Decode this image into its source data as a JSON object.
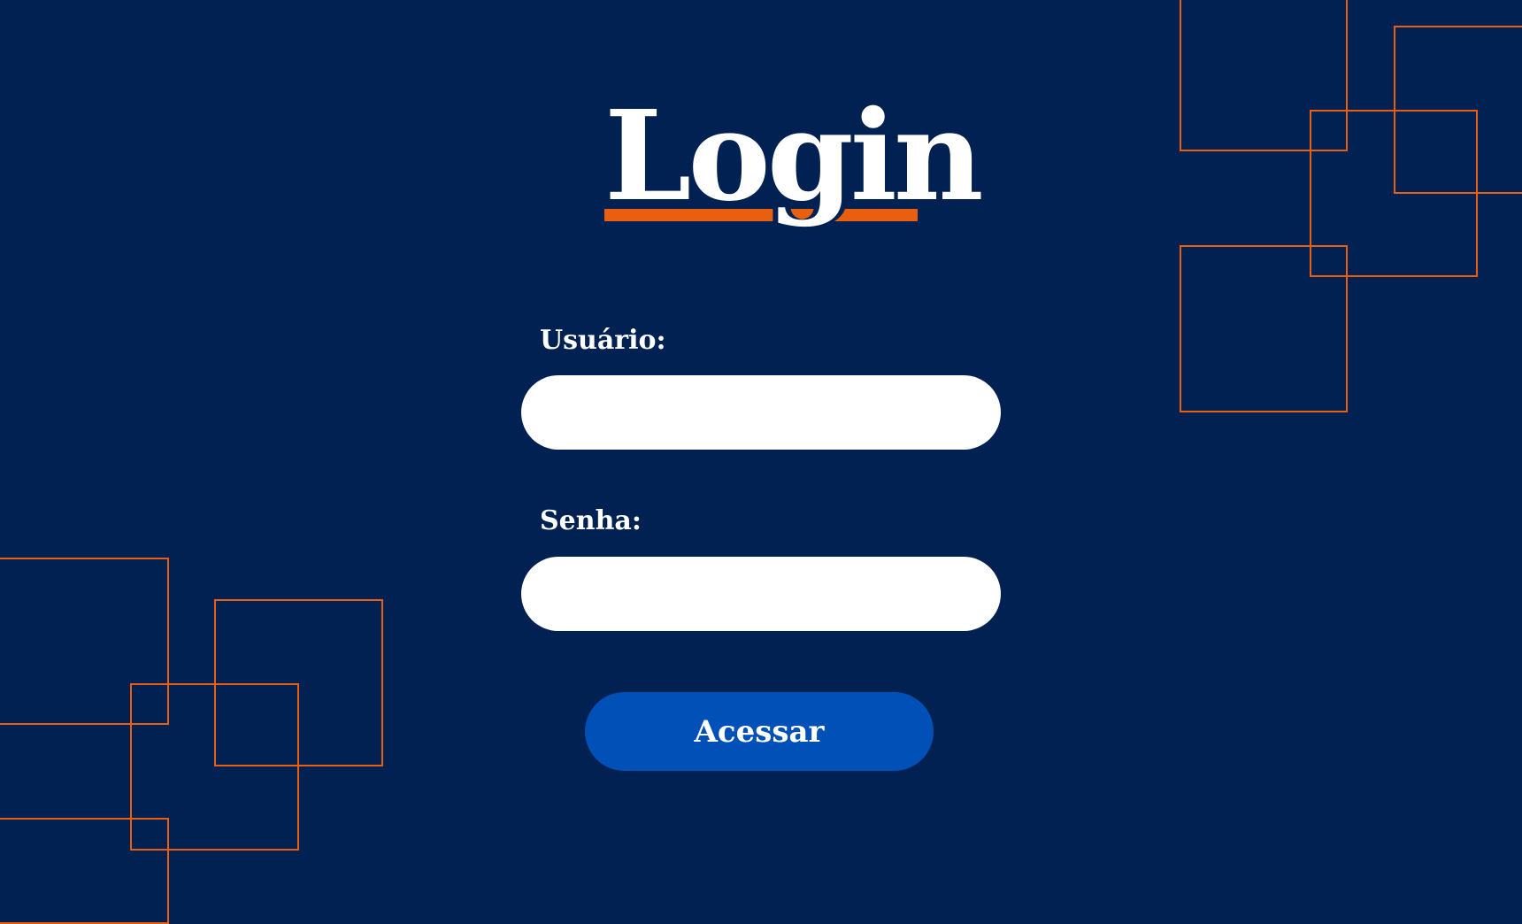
{
  "page": {
    "title": "Login"
  },
  "form": {
    "username": {
      "label": "Usuário:",
      "value": "",
      "placeholder": ""
    },
    "password": {
      "label": "Senha:",
      "value": "",
      "placeholder": ""
    },
    "submit_label": "Acessar"
  },
  "colors": {
    "background": "#002152",
    "accent": "#E8600F",
    "button": "#0050B8",
    "input_background": "#FFFFFF",
    "text": "#FFFFFF"
  }
}
